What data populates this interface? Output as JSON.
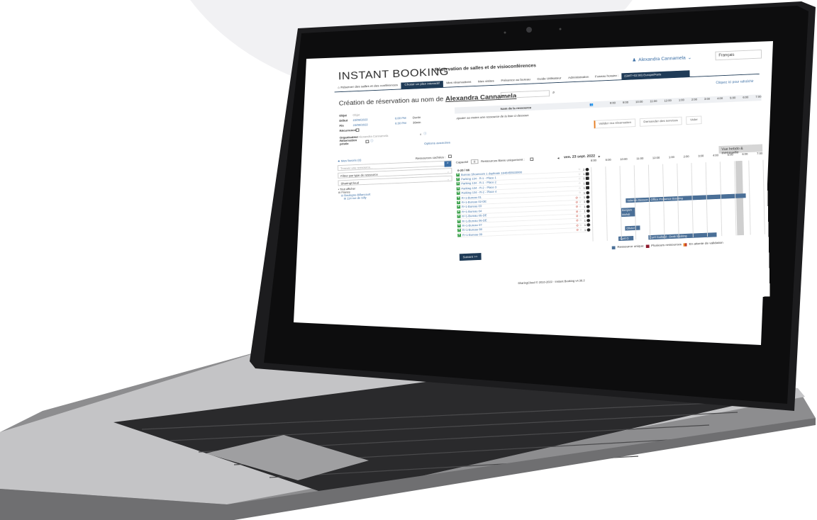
{
  "app": {
    "logo": "INSTANT BOOKING",
    "title": "Réservation de salles et de visioconférences",
    "user": "Alexandra Cannamela",
    "language": "Français",
    "refresh_link": "Cliquez ici pour rafraîchir"
  },
  "nav": {
    "tabs": [
      "Réserver des salles et des conférences",
      "Choisir un plan interactif",
      "Mes réservations",
      "Mes visites",
      "Présence au bureau",
      "Guide Utilisateur",
      "Administration"
    ],
    "timezone_label": "Fuseau horaire :",
    "timezone_value": "(GMT+02:00) Europe/Paris"
  },
  "form": {
    "heading_prefix": "Création de réservation au nom de",
    "heading_user": "Alexandra Cannamela",
    "object_label": "Objet",
    "object_placeholder": "Objet",
    "start_label": "Début",
    "start_date": "23/09/2022",
    "start_time": "6:00 PM",
    "end_label": "Fin",
    "end_date": "23/09/2022",
    "end_time": "6:30 PM",
    "duration_label": "Durée",
    "duration_value": "30min",
    "recurrence_label": "Récurrence",
    "organizer_label": "Organisateur",
    "organizer_value": "Alexandra Cannamela",
    "private_label": "Réservation privée",
    "advanced_options": "Options avancées"
  },
  "filters": {
    "favorites": "Mes favoris (0)",
    "hidden": "Ressources cachées :",
    "search_placeholder": "Trouver une ressource...",
    "type_filter": "Filtrer par type de ressource",
    "site": "SharingCloud",
    "tree": [
      "• Tout afficher",
      "⊟ France",
      "⊟ Boulogne-Billancourt",
      "⊞ 114 rue de Silly"
    ]
  },
  "resources": {
    "column_header": "Nom de la ressource",
    "hint": "Ajouter au moins une ressource de la liste ci-dessous",
    "times_top": [
      "8:00",
      "9:00",
      "10:00",
      "11:00",
      "12:00",
      "1:00",
      "2:00",
      "3:00",
      "4:00",
      "5:00",
      "6:00",
      "7:00"
    ],
    "count": "0-20 / 66",
    "capacity_label": "Capacité",
    "capacity_value": "0",
    "free_only": "Ressources libres uniquement :",
    "date": "ven. 23 sept. 2022",
    "week_button": "Vue hebdo & mensuelle",
    "times": [
      "8:00",
      "9:00",
      "10:00",
      "11:00",
      "12:00",
      "1:00",
      "2:00",
      "3:00",
      "4:00",
      "5:00",
      "6:00",
      "7:00"
    ],
    "rows": [
      {
        "name": "Bureau Showroom 1 duplicate 1648455533000",
        "cap": "2"
      },
      {
        "name": "Parking 134 - R-1 - Place 1",
        "cap": "1"
      },
      {
        "name": "Parking 134 - R-1 - Place 2",
        "cap": "1"
      },
      {
        "name": "Parking 134 - R-2 - Place 3",
        "cap": "1"
      },
      {
        "name": "Parking 134 - R-2 - Place 4",
        "cap": "1"
      },
      {
        "name": "R+1-Bureau 01",
        "cap": "1"
      },
      {
        "name": "R+1-Bureau 02-DE",
        "cap": "1"
      },
      {
        "name": "R+1-Bureau 03",
        "cap": "1"
      },
      {
        "name": "R+1-Bureau 04",
        "cap": "1"
      },
      {
        "name": "R+1-Bureau 05-DE",
        "cap": "1"
      },
      {
        "name": "R+1-Bureau 06-DE",
        "cap": "1"
      },
      {
        "name": "R+1-Bureau 07",
        "cap": "1"
      },
      {
        "name": "R+1-Bureau 08",
        "cap": "1"
      },
      {
        "name": "R+1-Bureau 09",
        "cap": "1"
      }
    ],
    "events": [
      "Valentin Besson - Office Presence Booking",
      "Benjam",
      "Mehdi",
      "Olivier",
      "Cyril G",
      "Cyril Guillard - Desk booking"
    ],
    "next_button": "Suivant >>",
    "actions": {
      "validate": "Valider ma réservation",
      "services": "Demander des services",
      "clear": "Vider"
    }
  },
  "legend": {
    "single": "Ressource unique",
    "multiple": "Plusieurs ressources",
    "pending": "En attente de validation"
  },
  "footer": "SharingCloud © 2010-2022 - Instant Booking v4.36.2"
}
